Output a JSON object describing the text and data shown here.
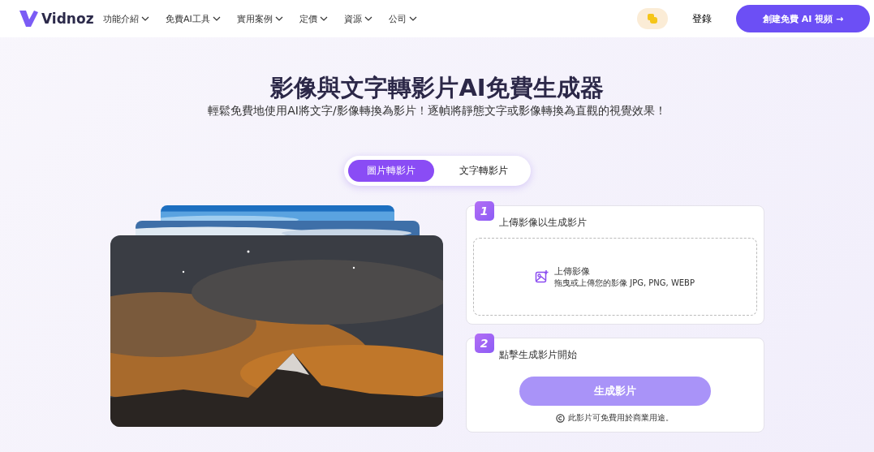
{
  "nav": {
    "logo": "Vidnoz",
    "menu": [
      {
        "label": "功能介紹"
      },
      {
        "label": "免費AI工具"
      },
      {
        "label": "實用案例"
      },
      {
        "label": "定價"
      },
      {
        "label": "資源"
      },
      {
        "label": "公司"
      }
    ],
    "login": "登錄",
    "cta": "創建免費 AI 視頻 →"
  },
  "hero": {
    "title": "影像與文字轉影片AI免費生成器",
    "subtitle": "輕鬆免費地使用AI將文字/影像轉換為影片！逐幀將靜態文字或影像轉換為直觀的視覺效果！"
  },
  "tabs": [
    {
      "label": "圖片轉影片",
      "selected": true
    },
    {
      "label": "文字轉影片",
      "selected": false
    }
  ],
  "steps": [
    {
      "number": "1",
      "kind": "upload",
      "title": "上傳影像以生成影片",
      "upload_title": "上傳影像",
      "upload_hint": "拖曳或上傳您的影像 JPG, PNG, WEBP"
    },
    {
      "number": "2",
      "kind": "generate",
      "title": "點擊生成影片開始",
      "button": "生成影片",
      "disabled": true,
      "note": "此影片可免費用於商業用途。"
    }
  ]
}
